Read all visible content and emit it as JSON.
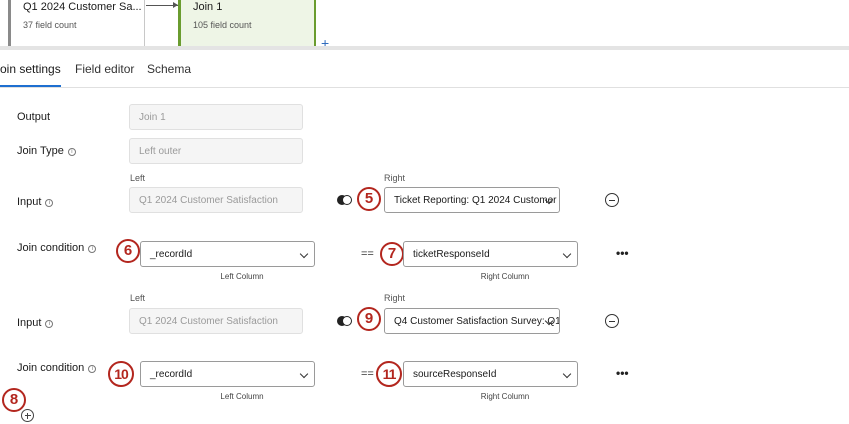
{
  "canvas": {
    "source_node": {
      "title": "Q1 2024 Customer Sa...",
      "sub": "37 field count"
    },
    "join_node": {
      "title": "Join 1",
      "sub": "105 field count"
    },
    "add_symbol": "+"
  },
  "tabs": [
    "Join settings",
    "Field editor",
    "Schema"
  ],
  "form": {
    "output_label": "Output",
    "output_value": "Join 1",
    "join_type_label": "Join Type",
    "join_type_value": "Left outer",
    "left_header": "Left",
    "right_header": "Right",
    "input_label": "Input",
    "join_condition_label": "Join condition",
    "left_column_caption": "Left Column",
    "right_column_caption": "Right Column",
    "eq": "==",
    "more": "•••",
    "info": "i",
    "inputs": [
      {
        "left": "Q1 2024 Customer Satisfaction",
        "right": "Ticket Reporting: Q1 2024 Customer",
        "cond_left": "_recordId",
        "cond_right": "ticketResponseId"
      },
      {
        "left": "Q1 2024 Customer Satisfaction",
        "right": "Q4 Customer Satisfaction Survey: Q1",
        "cond_left": "_recordId",
        "cond_right": "sourceResponseId"
      }
    ]
  },
  "annotations": [
    "5",
    "6",
    "7",
    "8",
    "9",
    "10",
    "11"
  ],
  "colors": {
    "accent": "#1e6fd0",
    "join_node_bg": "#eef5e6",
    "join_node_border": "#6a9c2f",
    "annotation": "#b3261e"
  }
}
